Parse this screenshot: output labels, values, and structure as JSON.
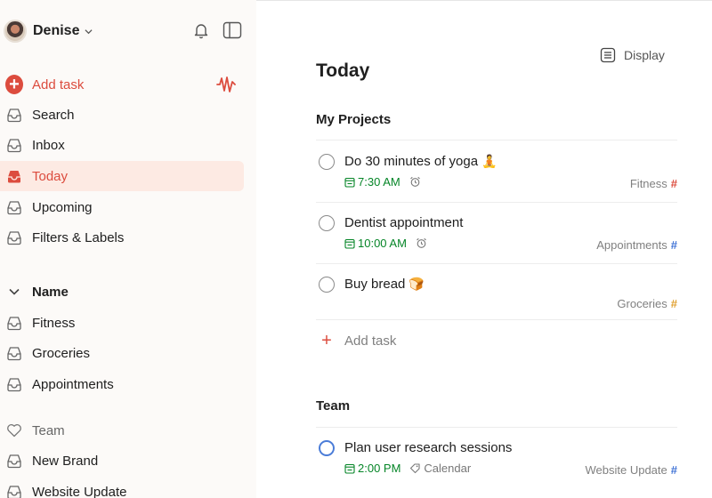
{
  "user": {
    "name": "Denise"
  },
  "nav": {
    "add_task": "Add task",
    "items": [
      {
        "label": "Search",
        "icon": "search-icon"
      },
      {
        "label": "Inbox",
        "icon": "inbox-icon"
      },
      {
        "label": "Today",
        "icon": "today-icon",
        "active": true
      },
      {
        "label": "Upcoming",
        "icon": "upcoming-icon"
      },
      {
        "label": "Filters & Labels",
        "icon": "filters-icon"
      }
    ]
  },
  "sections": {
    "name_group": {
      "label": "Name",
      "projects": [
        "Fitness",
        "Groceries",
        "Appointments"
      ]
    },
    "team_group": {
      "label": "Team",
      "projects": [
        "New Brand",
        "Website Update"
      ]
    }
  },
  "main": {
    "display_label": "Display",
    "title": "Today",
    "my_projects": {
      "label": "My Projects",
      "tasks": [
        {
          "title": "Do 30 minutes of yoga",
          "emoji": "🧘",
          "time": "7:30 AM",
          "reminder": true,
          "project": "Fitness",
          "hash_color": "#dc4c3e"
        },
        {
          "title": "Dentist appointment",
          "emoji": "",
          "time": "10:00 AM",
          "reminder": true,
          "project": "Appointments",
          "hash_color": "#4073d6"
        },
        {
          "title": "Buy bread",
          "emoji": "🍞",
          "time": "",
          "reminder": false,
          "project": "Groceries",
          "hash_color": "#e0a030"
        }
      ],
      "add_task_label": "Add task"
    },
    "team": {
      "label": "Team",
      "tasks": [
        {
          "title": "Plan user research sessions",
          "time": "2:00 PM",
          "label": "Calendar",
          "project": "Website Update",
          "hash_color": "#4073d6"
        }
      ]
    }
  },
  "colors": {
    "accent": "#dc4c3e",
    "active_bg": "#fdeae3",
    "date_green": "#058527",
    "sidebar_bg": "#fcfaf8"
  }
}
